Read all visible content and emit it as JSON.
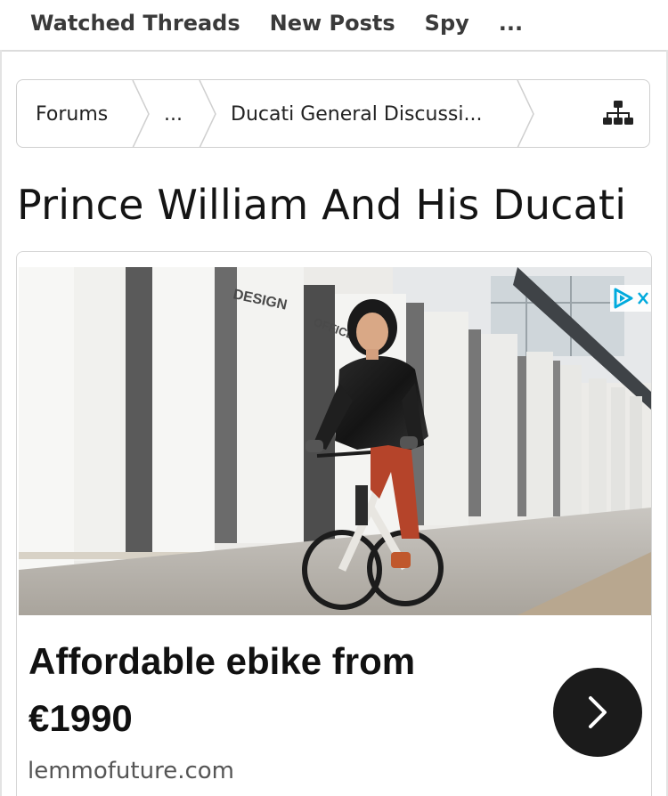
{
  "nav": {
    "tabs": [
      {
        "label": "Watched Threads"
      },
      {
        "label": "New Posts"
      },
      {
        "label": "Spy"
      },
      {
        "label": "..."
      }
    ]
  },
  "breadcrumb": {
    "items": [
      {
        "label": "Forums"
      },
      {
        "label": "..."
      },
      {
        "label": "Ducati General Discussi..."
      }
    ],
    "sitemap_icon": "sitemap-icon"
  },
  "thread": {
    "title": "Prince William And His Ducati"
  },
  "ad": {
    "image_signs": [
      "DESIGN",
      "OFFICES"
    ],
    "headline": "Affordable ebike from €1990",
    "domain": "lemmofuture.com",
    "adchoices_icon": "ad-choices-icon",
    "cta_icon": "chevron-right-icon",
    "accent": "#00aadd"
  }
}
